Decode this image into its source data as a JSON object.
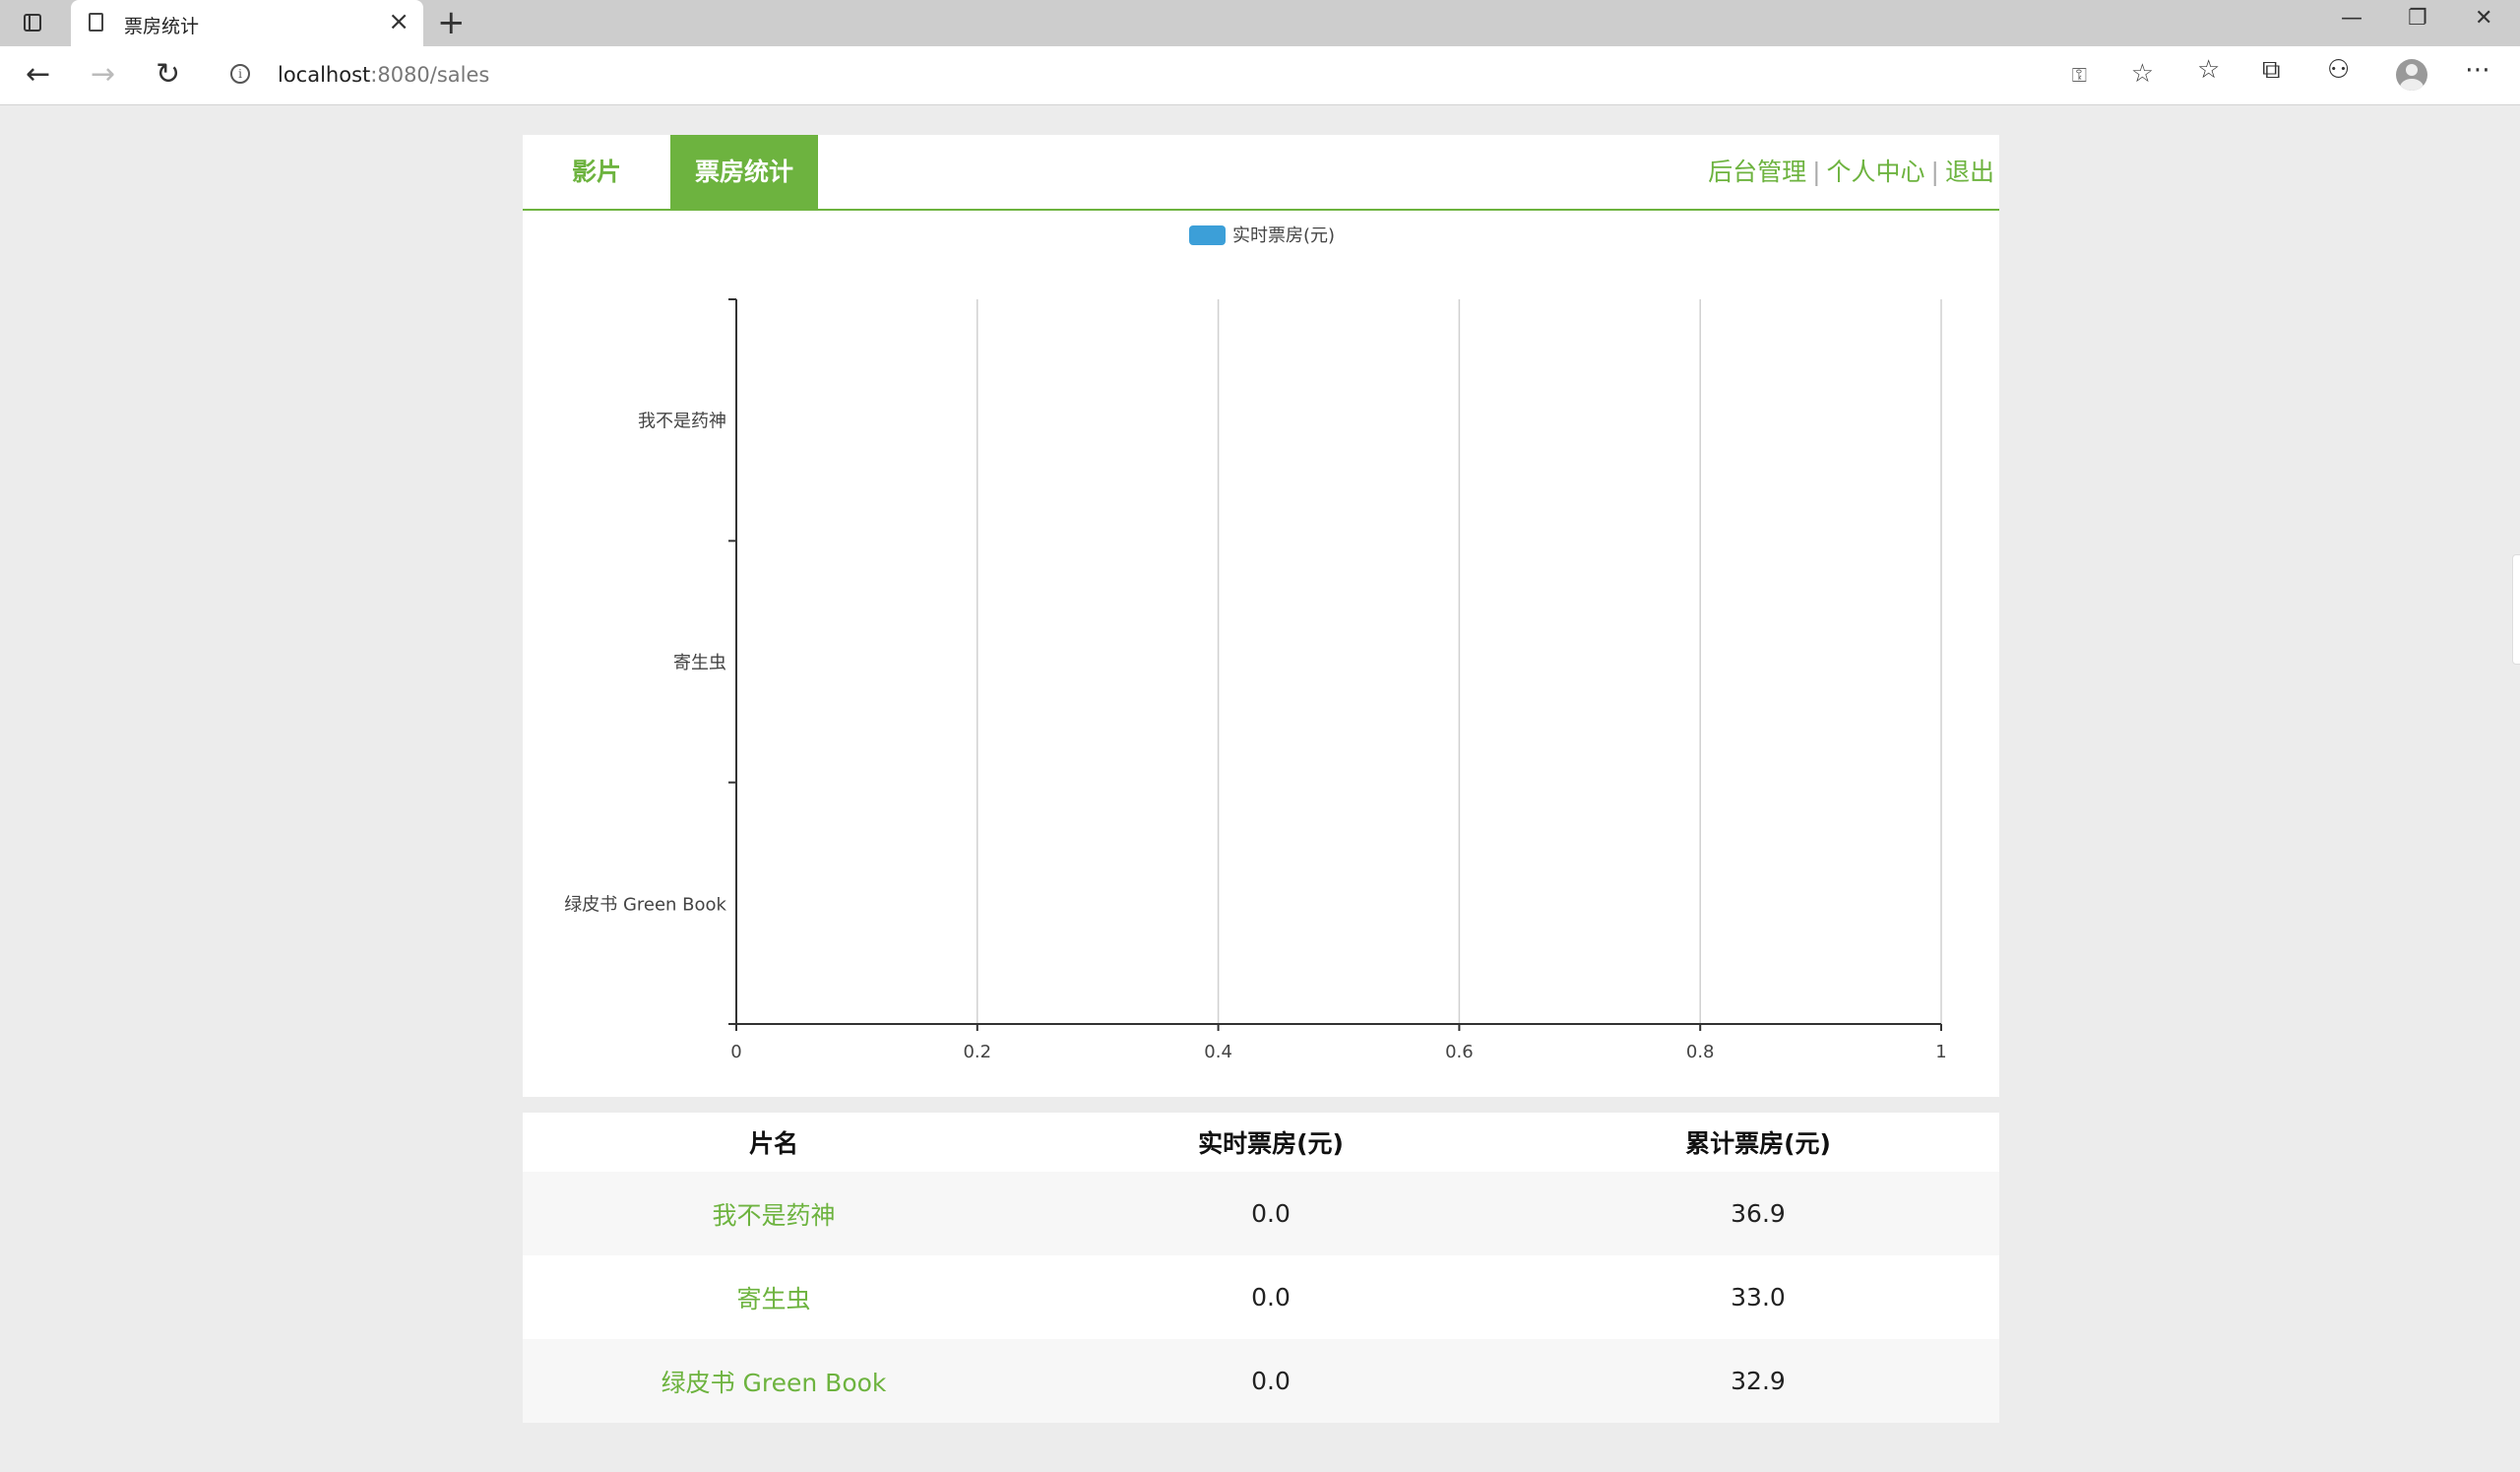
{
  "browser": {
    "tab_title": "票房统计",
    "url_host": "localhost",
    "url_path": ":8080/sales"
  },
  "nav": {
    "tabs": [
      {
        "label": "影片",
        "active": false
      },
      {
        "label": "票房统计",
        "active": true
      }
    ],
    "links": [
      "后台管理",
      "个人中心",
      "退出"
    ],
    "accent_color": "#6db33f"
  },
  "chart_data": {
    "type": "bar",
    "orientation": "horizontal",
    "categories": [
      "我不是药神",
      "寄生虫",
      "绿皮书 Green Book"
    ],
    "series": [
      {
        "name": "实时票房(元)",
        "values": [
          0,
          0,
          0
        ],
        "color": "#3c9fd8"
      }
    ],
    "xlim": [
      0,
      1
    ],
    "x_ticks": [
      "0",
      "0.2",
      "0.4",
      "0.6",
      "0.8",
      "1"
    ],
    "grid": true,
    "legend": "top-center"
  },
  "table": {
    "headers": [
      "片名",
      "实时票房(元)",
      "累计票房(元)"
    ],
    "rows": [
      [
        "我不是药神",
        "0.0",
        "36.9"
      ],
      [
        "寄生虫",
        "0.0",
        "33.0"
      ],
      [
        "绿皮书 Green Book",
        "0.0",
        "32.9"
      ]
    ]
  }
}
